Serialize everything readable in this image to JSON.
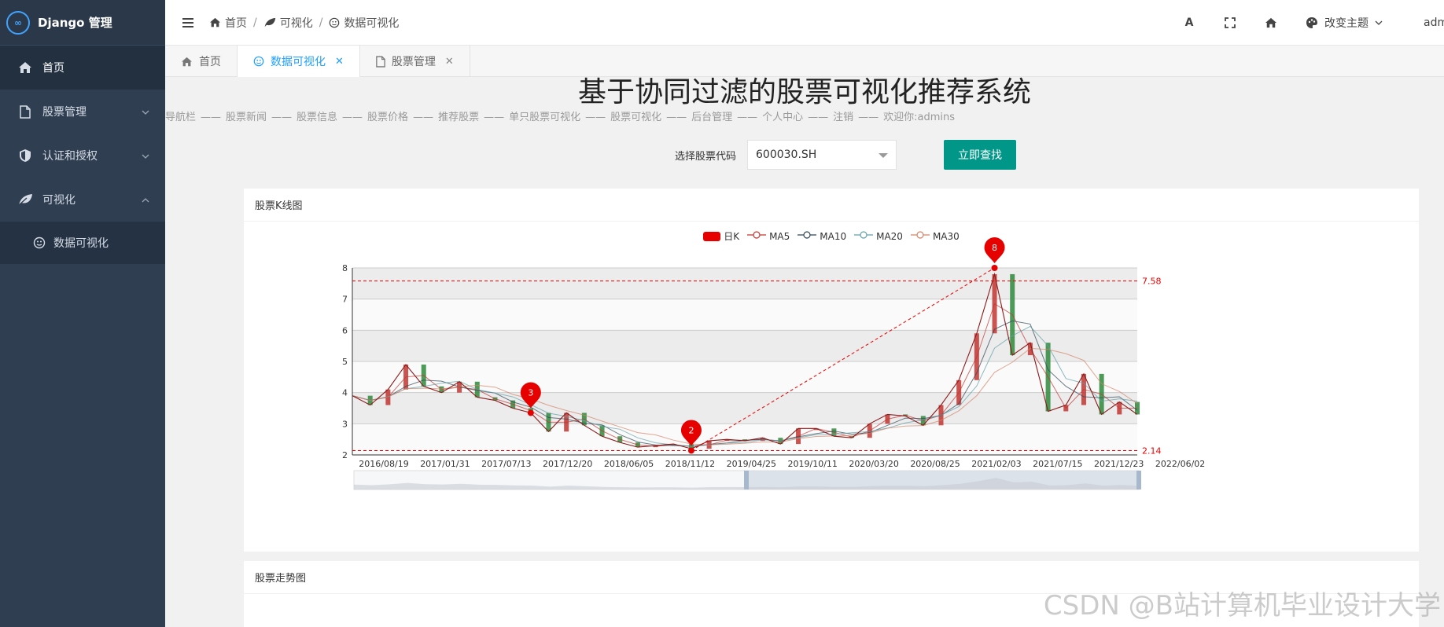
{
  "app": {
    "logo_text": "Django 管理",
    "logo_glyph": "∞"
  },
  "sidebar": {
    "items": [
      {
        "label": "首页",
        "icon": "home-icon"
      },
      {
        "label": "股票管理",
        "icon": "file-icon"
      },
      {
        "label": "认证和授权",
        "icon": "shield-icon"
      },
      {
        "label": "可视化",
        "icon": "leaf-icon"
      }
    ],
    "sub_items": [
      {
        "label": "数据可视化",
        "icon": "smile-icon"
      }
    ]
  },
  "header": {
    "breadcrumb": [
      "首页",
      "可视化",
      "数据可视化"
    ],
    "font_icon_label": "A",
    "theme_label": "改变主题",
    "user_label": "admins"
  },
  "tabs": [
    {
      "label": "首页"
    },
    {
      "label": "数据可视化"
    },
    {
      "label": "股票管理"
    }
  ],
  "page": {
    "title": "基于协同过滤的股票可视化推荐系统",
    "nav_items": [
      "导航栏",
      "——",
      "股票新闻",
      "——",
      "股票信息",
      "——",
      "股票价格",
      "——",
      "推荐股票",
      "——",
      "单只股票可视化",
      "——",
      "股票可视化",
      "——",
      "后台管理",
      "——",
      "个人中心",
      "——",
      "注销",
      "——",
      "欢迎你:admins"
    ],
    "search_label": "选择股票代码",
    "search_value": "600030.SH",
    "search_button": "立即查找"
  },
  "cards": {
    "kline_title": "股票K线图",
    "trend_title": "股票走势图"
  },
  "watermark": "CSDN @B站计算机毕业设计大学",
  "colors": {
    "accent": "#009688",
    "sidebar": "#2f3e51",
    "tab_active": "#1e9fff",
    "candle_up": "#c23531",
    "candle_down": "#2f8a3c"
  },
  "chart_data": {
    "type": "line",
    "title": "",
    "legend": [
      "日K",
      "MA5",
      "MA10",
      "MA20",
      "MA30"
    ],
    "series_colors": [
      "#e60000",
      "#c23531",
      "#2f4554",
      "#61a0a8",
      "#d48265"
    ],
    "x_ticks": [
      "2016/08/19",
      "2017/01/31",
      "2017/07/13",
      "2017/12/20",
      "2018/06/05",
      "2018/11/12",
      "2019/04/25",
      "2019/10/11",
      "2020/03/20",
      "2020/08/25",
      "2021/02/03",
      "2021/07/15",
      "2021/12/23",
      "2022/06/02"
    ],
    "ylim": [
      2,
      8
    ],
    "y_ticks": [
      2,
      3,
      4,
      5,
      6,
      7,
      8
    ],
    "x": [
      "2016/06",
      "2016/08",
      "2016/10",
      "2016/12",
      "2017/01",
      "2017/03",
      "2017/05",
      "2017/07",
      "2017/09",
      "2017/11",
      "2017/12",
      "2018/02",
      "2018/04",
      "2018/06",
      "2018/08",
      "2018/10",
      "2018/11",
      "2019/01",
      "2019/03",
      "2019/04",
      "2019/05",
      "2019/07",
      "2019/09",
      "2019/10",
      "2019/12",
      "2020/02",
      "2020/03",
      "2020/05",
      "2020/07",
      "2020/08",
      "2020/10",
      "2020/12",
      "2021/02",
      "2021/03",
      "2021/04",
      "2021/05",
      "2021/06",
      "2021/07",
      "2021/08",
      "2021/09",
      "2021/10",
      "2021/12",
      "2022/02",
      "2022/04",
      "2022/06"
    ],
    "close": [
      3.9,
      3.6,
      4.1,
      4.9,
      4.2,
      4.0,
      4.35,
      3.85,
      3.75,
      3.5,
      3.35,
      2.75,
      3.35,
      2.95,
      2.6,
      2.4,
      2.25,
      2.3,
      2.35,
      2.2,
      2.45,
      2.5,
      2.45,
      2.55,
      2.35,
      2.85,
      2.85,
      2.6,
      2.55,
      3.0,
      3.3,
      3.25,
      2.95,
      3.6,
      4.4,
      5.9,
      7.8,
      5.2,
      5.6,
      3.4,
      3.6,
      4.6,
      3.3,
      3.7,
      3.3
    ],
    "markers": [
      {
        "label": "8",
        "type": "max",
        "value": 7.58
      },
      {
        "label": "2",
        "type": "min",
        "value": 2.14
      },
      {
        "label": "3",
        "type": "point",
        "value": 3.35
      }
    ],
    "markline": [
      7.58,
      2.14
    ],
    "grid": true
  }
}
